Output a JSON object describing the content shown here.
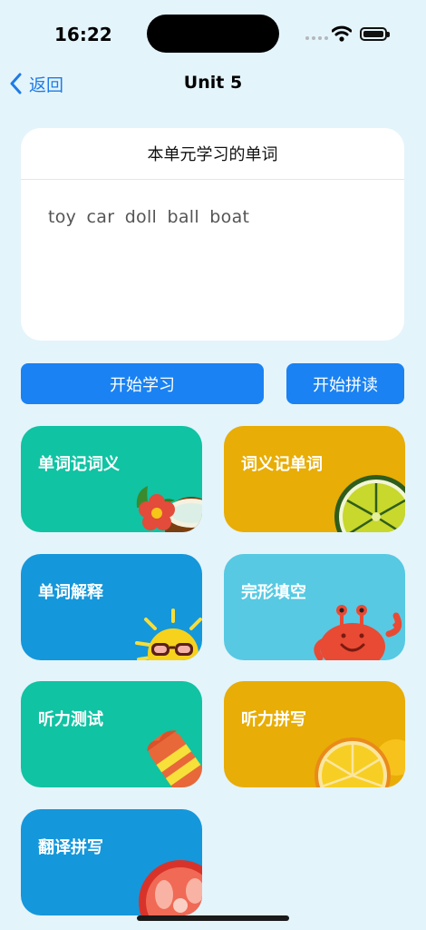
{
  "status": {
    "time": "16:22"
  },
  "nav": {
    "back_label": "返回",
    "title": "Unit 5"
  },
  "words_card": {
    "title": "本单元学习的单词",
    "words": "toy  car  doll  ball  boat"
  },
  "actions": {
    "learn_label": "开始学习",
    "spell_label": "开始拼读"
  },
  "tiles": [
    {
      "label": "单词记词义",
      "color": "#10c3a3",
      "icon": "coconut-flower-icon"
    },
    {
      "label": "词义记单词",
      "color": "#e8ad06",
      "icon": "lime-slice-icon"
    },
    {
      "label": "单词解释",
      "color": "#1597db",
      "icon": "sun-sunglasses-icon"
    },
    {
      "label": "完形填空",
      "color": "#57c9e3",
      "icon": "crab-icon"
    },
    {
      "label": "听力测试",
      "color": "#10c3a3",
      "icon": "popsicle-icon"
    },
    {
      "label": "听力拼写",
      "color": "#e8ad06",
      "icon": "lemon-slice-icon"
    },
    {
      "label": "翻译拼写",
      "color": "#1597db",
      "icon": "tomato-slice-icon"
    }
  ]
}
